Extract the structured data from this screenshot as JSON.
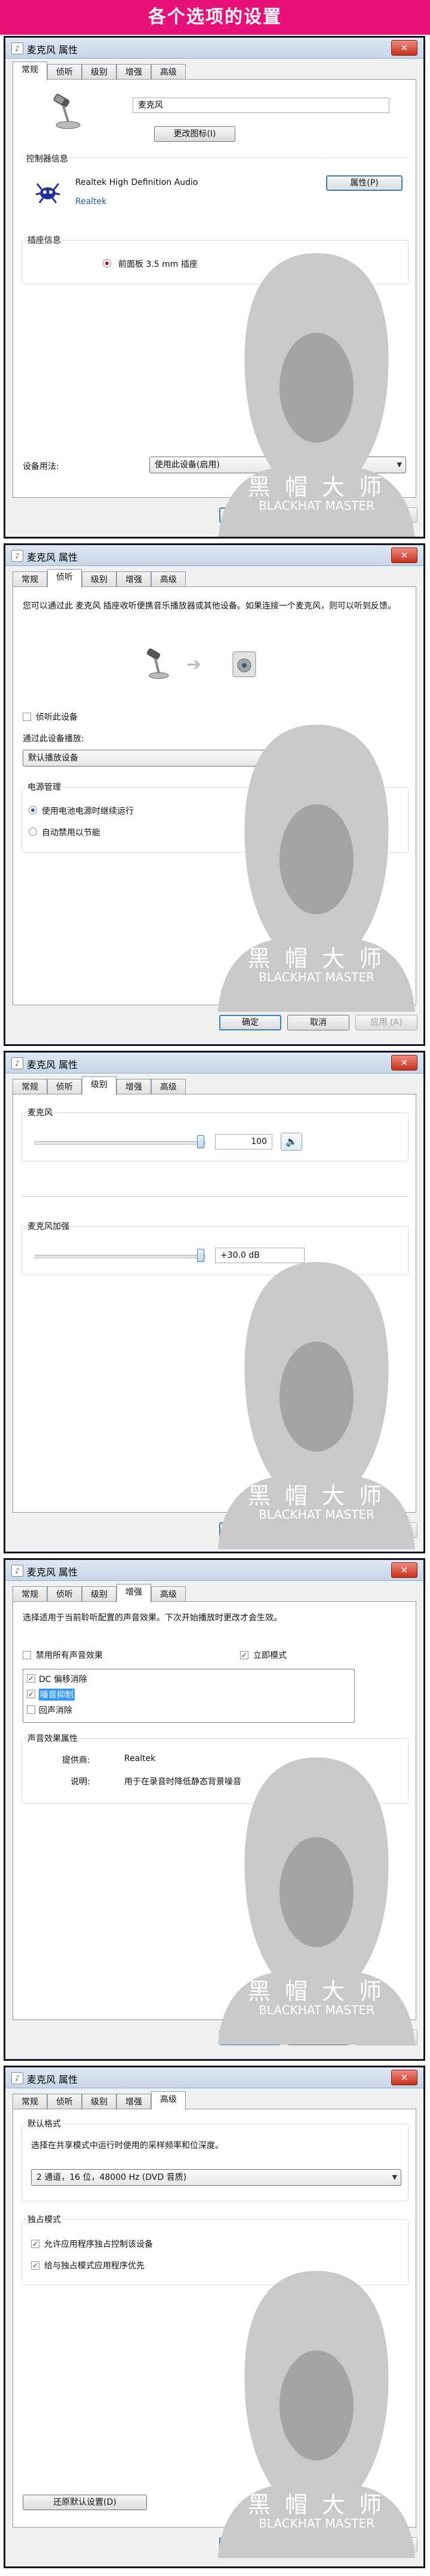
{
  "banner": {
    "title": "各个选项的设置"
  },
  "dialog": {
    "title": "麦克风 属性",
    "close": "✕",
    "tabs": [
      "常规",
      "侦听",
      "级别",
      "增强",
      "高级"
    ],
    "ok": "确定",
    "cancel": "取消",
    "apply": "应用 (A)"
  },
  "watermark": {
    "line1": "黑 帽 大 师",
    "line2": "BLACKHAT MASTER"
  },
  "general": {
    "device_name": "麦克风",
    "change_icon": "更改图标(I)",
    "controller_label": "控制器信息",
    "controller_name": "Realtek High Definition Audio",
    "controller_vendor": "Realtek",
    "properties_button": "属性(P)",
    "jack_label": "插座信息",
    "jack_value": "前面板 3.5 mm 插座",
    "usage_label": "设备用法:",
    "usage_value": "使用此设备(启用)"
  },
  "listen": {
    "description": "您可以通过此 麦克风 插座收听便携音乐播放器或其他设备。如果连接一个麦克风，则可以听到反馈。",
    "listen_checkbox": "侦听此设备",
    "playback_label": "通过此设备播放:",
    "playback_value": "默认播放设备",
    "power_label": "电源管理",
    "power_option1": "使用电池电源时继续运行",
    "power_option2": "自动禁用以节能"
  },
  "levels": {
    "mic_label": "麦克风",
    "mic_value": "100",
    "mic_level": 100,
    "boost_label": "麦克风加强",
    "boost_value": "+30.0 dB",
    "boost_level": 100
  },
  "enhancements": {
    "description": "选择适用于当前聆听配置的声音效果。下次开始播放时更改才会生效。",
    "disable_all": "禁用所有声音效果",
    "immediate": "立即模式",
    "effects": [
      {
        "label": "DC 偏移消除",
        "checked": true
      },
      {
        "label": "噪音抑制",
        "checked": true
      },
      {
        "label": "回声消除",
        "checked": false
      }
    ],
    "props_label": "声音效果属性",
    "provider_label": "提供商:",
    "provider_value": "Realtek",
    "desc_label": "说明:",
    "desc_value": "用于在录音时降低静态背景噪音"
  },
  "advanced": {
    "format_label": "默认格式",
    "format_desc": "选择在共享模式中运行时使用的采样频率和位深度。",
    "format_value": "2 通道，16 位，48000 Hz (DVD 音质)",
    "exclusive_label": "独占模式",
    "exclusive_opt1": "允许应用程序独占控制该设备",
    "exclusive_opt2": "给与独占模式应用程序优先",
    "restore_default": "还原默认设置(D)"
  }
}
